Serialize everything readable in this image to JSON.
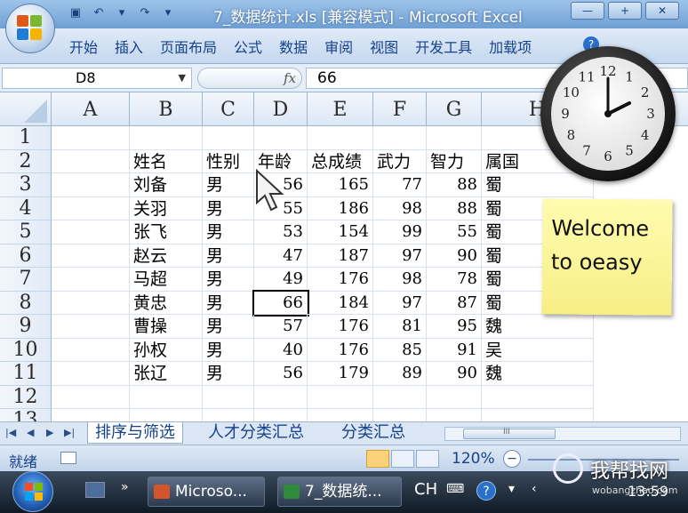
{
  "window": {
    "title": "7_数据统计.xls  [兼容模式] - Microsoft Excel",
    "controls": [
      "—",
      "+",
      "✕"
    ]
  },
  "ribbon": {
    "tabs": [
      "开始",
      "插入",
      "页面布局",
      "公式",
      "数据",
      "审阅",
      "视图",
      "开发工具",
      "加载项"
    ]
  },
  "formula_bar": {
    "cell_ref": "D8",
    "fx_label": "fx",
    "value": "66"
  },
  "grid": {
    "columns": [
      "A",
      "B",
      "C",
      "D",
      "E",
      "F",
      "G",
      "H"
    ],
    "rows": [
      "1",
      "2",
      "3",
      "4",
      "5",
      "6",
      "7",
      "8",
      "9",
      "10",
      "11",
      "12",
      "13"
    ],
    "headers": [
      "姓名",
      "性别",
      "年龄",
      "总成绩",
      "武力",
      "智力",
      "属国"
    ],
    "data": [
      [
        "刘备",
        "男",
        "56",
        "165",
        "77",
        "88",
        "蜀"
      ],
      [
        "关羽",
        "男",
        "55",
        "186",
        "98",
        "88",
        "蜀"
      ],
      [
        "张飞",
        "男",
        "53",
        "154",
        "99",
        "55",
        "蜀"
      ],
      [
        "赵云",
        "男",
        "47",
        "187",
        "97",
        "90",
        "蜀"
      ],
      [
        "马超",
        "男",
        "49",
        "176",
        "98",
        "78",
        "蜀"
      ],
      [
        "黄忠",
        "男",
        "66",
        "184",
        "97",
        "87",
        "蜀"
      ],
      [
        "曹操",
        "男",
        "57",
        "176",
        "81",
        "95",
        "魏"
      ],
      [
        "孙权",
        "男",
        "40",
        "176",
        "85",
        "91",
        "吴"
      ],
      [
        "张辽",
        "男",
        "56",
        "179",
        "89",
        "90",
        "魏"
      ]
    ]
  },
  "sheets": {
    "tabs": [
      "排序与筛选",
      "人才分类汇总",
      "分类汇总"
    ],
    "active": "排序与筛选",
    "scroll_label": "III"
  },
  "status": {
    "ready": "就绪",
    "zoom": "120%",
    "zoom_minus": "−"
  },
  "taskbar": {
    "tasks": [
      "Microso...",
      "7_数据统..."
    ],
    "lang": "CH",
    "time": "13:59",
    "more": "»"
  },
  "gadgets": {
    "note_text": "Welcome to oeasy",
    "clock_numbers": [
      "12",
      "1",
      "2",
      "3",
      "4",
      "5",
      "6",
      "7",
      "8",
      "9",
      "10",
      "11"
    ]
  },
  "watermark": {
    "text": "我帮找网",
    "url": "wobangzhao.com"
  },
  "colors": {
    "ribbon_text": "#15428b",
    "titlebar": "#7aa7da",
    "taskbar": "#1e2a38",
    "note": "#fbf39a"
  }
}
